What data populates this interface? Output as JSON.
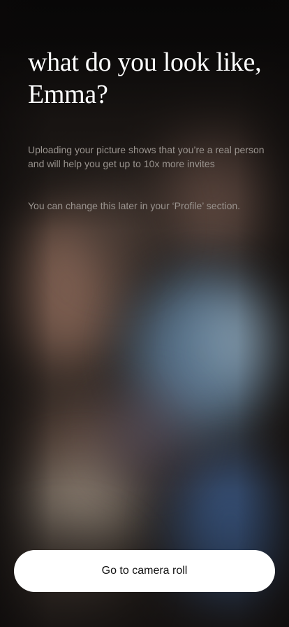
{
  "onboarding": {
    "title": "what do you look like, Emma?",
    "description": "Uploading your picture shows that you’re a real person and will help you get up to 10x more invites",
    "note": "You can change this later in your ‘Profile’ section.",
    "primary_button_label": "Go to camera roll"
  }
}
